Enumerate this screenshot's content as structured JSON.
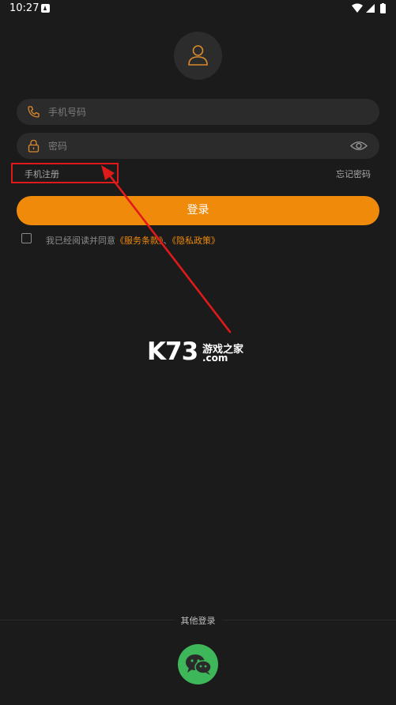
{
  "status_bar": {
    "time": "10:27"
  },
  "login": {
    "phone_placeholder": "手机号码",
    "password_placeholder": "密码",
    "register_label": "手机注册",
    "forgot_label": "忘记密码",
    "login_button": "登录",
    "agree_prefix": "我已经阅读并同意",
    "terms_link": "《服务条款》",
    "separator": "、",
    "privacy_link": "《隐私政策》"
  },
  "watermark": {
    "logo": "K73",
    "name": "游戏之家",
    "domain": ".com"
  },
  "other_login": {
    "label": "其他登录",
    "wechat_icon": "wechat-icon"
  },
  "colors": {
    "accent": "#ef8a0a",
    "background": "#1b1b1b",
    "field_background": "#2b2b2b",
    "annotation_red": "#e01a1a",
    "wechat_green": "#3db75a"
  }
}
